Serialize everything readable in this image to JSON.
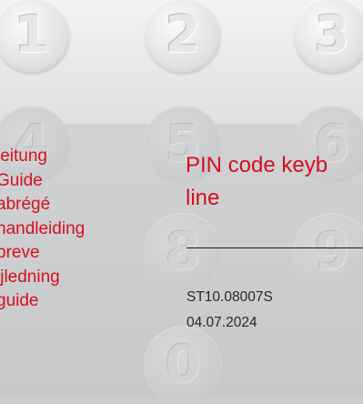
{
  "keypad": {
    "keys": [
      "1",
      "2",
      "3",
      "4",
      "5",
      "6",
      "8",
      "9",
      "0"
    ]
  },
  "languages": [
    "leitung",
    "Guide",
    "abrégé",
    "handleiding",
    "breve",
    "ijledning",
    "guide"
  ],
  "document": {
    "title_line1": "PIN code keyb",
    "title_line2": "line",
    "number": "ST10.08007S",
    "date": "04.07.2024"
  },
  "colors": {
    "accent_red": "#d5101e",
    "text_dark": "#2a2a2a"
  }
}
